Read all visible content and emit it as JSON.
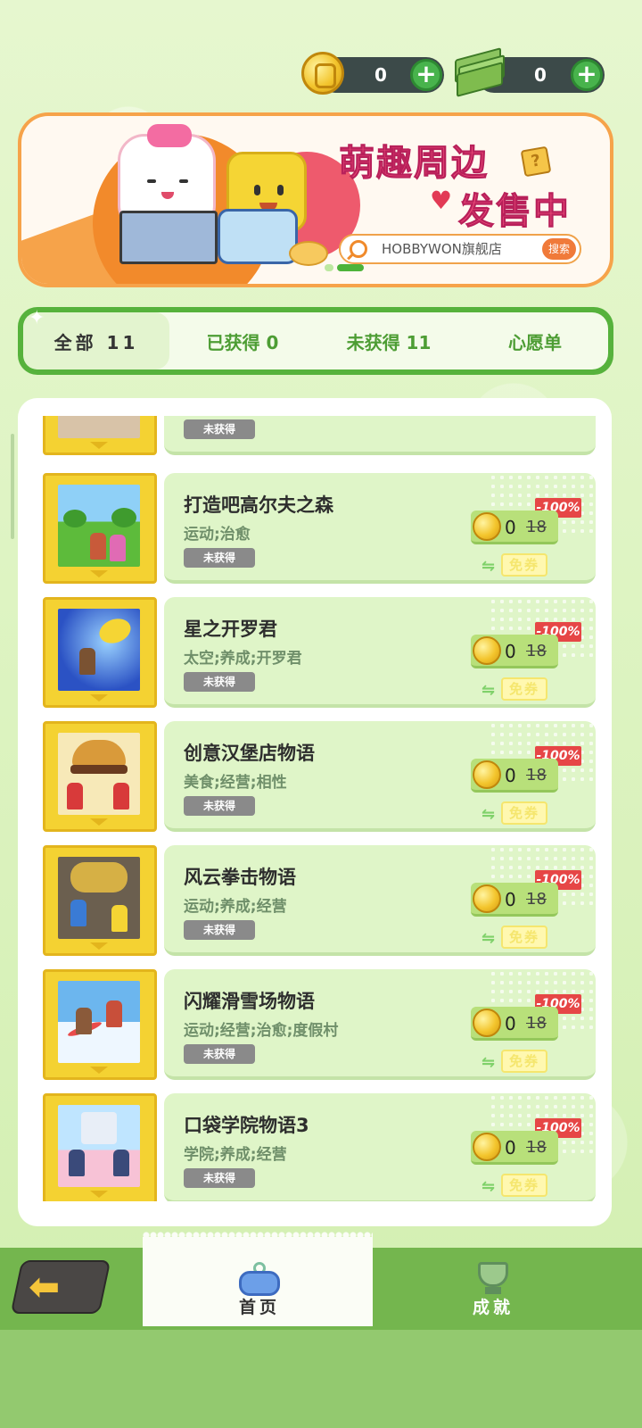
{
  "currency": {
    "coins": {
      "value": "0",
      "icon": "gold-coin-icon"
    },
    "cash": {
      "value": "0",
      "icon": "cash-stack-icon"
    }
  },
  "banner": {
    "title_line1": "萌趣周边",
    "title_line2": "发售中",
    "search_text": "HOBBYWON旗舰店",
    "search_button": "搜索"
  },
  "tabs": [
    {
      "label": "全部 11",
      "active": true
    },
    {
      "label": "已获得 0",
      "active": false
    },
    {
      "label": "未获得 11",
      "active": false
    },
    {
      "label": "心愿单",
      "active": false
    }
  ],
  "status_label": "未获得",
  "games": [
    {
      "title": "打造吧高尔夫之森",
      "tags": "运动;治愈",
      "status": "未获得",
      "discount": "-100%",
      "price_now": "0",
      "price_old": "18",
      "coupon": "免券",
      "art": "golf"
    },
    {
      "title": "星之开罗君",
      "tags": "太空;养成;开罗君",
      "status": "未获得",
      "discount": "-100%",
      "price_now": "0",
      "price_old": "18",
      "coupon": "免券",
      "art": "space"
    },
    {
      "title": "创意汉堡店物语",
      "tags": "美食;经营;相性",
      "status": "未获得",
      "discount": "-100%",
      "price_now": "0",
      "price_old": "18",
      "coupon": "免券",
      "art": "burger"
    },
    {
      "title": "风云拳击物语",
      "tags": "运动;养成;经营",
      "status": "未获得",
      "discount": "-100%",
      "price_now": "0",
      "price_old": "18",
      "coupon": "免券",
      "art": "boxing"
    },
    {
      "title": "闪耀滑雪场物语",
      "tags": "运动;经营;治愈;度假村",
      "status": "未获得",
      "discount": "-100%",
      "price_now": "0",
      "price_old": "18",
      "coupon": "免券",
      "art": "ski"
    },
    {
      "title": "口袋学院物语3",
      "tags": "学院;养成;经营",
      "status": "未获得",
      "discount": "-100%",
      "price_now": "0",
      "price_old": "18",
      "coupon": "免券",
      "art": "school"
    }
  ],
  "bottom_nav": {
    "back_icon": "back-arrow-icon",
    "home_label": "首页",
    "achievements_label": "成就"
  },
  "colors": {
    "accent_green": "#56b23c",
    "discount_red": "#e64646",
    "title_pink": "#ee4b7a"
  }
}
